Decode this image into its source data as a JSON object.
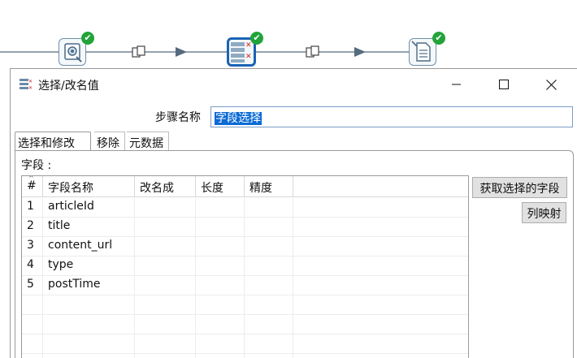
{
  "canvas": {
    "steps": [
      {
        "name": "input-step",
        "status": "ok"
      },
      {
        "name": "select-values-step",
        "status": "ok",
        "selected": true
      },
      {
        "name": "output-step",
        "status": "ok"
      }
    ],
    "ok_glyph": "✔",
    "colors": {
      "hop": "#556b7f",
      "ok": "#22a33a",
      "selected": "#1a63b4"
    }
  },
  "dialog": {
    "title": "选择/改名值",
    "step_name_label": "步骤名称",
    "step_name_value": "字段选择",
    "tabs": [
      {
        "label": "选择和修改",
        "active": true
      },
      {
        "label": "移除",
        "active": false
      },
      {
        "label": "元数据",
        "active": false
      }
    ],
    "fields_label": "字段 :",
    "table": {
      "columns": [
        "#",
        "字段名称",
        "改名成",
        "长度",
        "精度"
      ],
      "rows": [
        {
          "num": "1",
          "field": "articleId",
          "rename": "",
          "length": "",
          "precision": ""
        },
        {
          "num": "2",
          "field": "title",
          "rename": "",
          "length": "",
          "precision": ""
        },
        {
          "num": "3",
          "field": "content_url",
          "rename": "",
          "length": "",
          "precision": ""
        },
        {
          "num": "4",
          "field": "type",
          "rename": "",
          "length": "",
          "precision": ""
        },
        {
          "num": "5",
          "field": "postTime",
          "rename": "",
          "length": "",
          "precision": ""
        }
      ]
    },
    "buttons": {
      "get_fields": "获取选择的字段",
      "column_mapping": "列映射"
    },
    "window_controls": {
      "minimize": "minimize-icon",
      "maximize": "maximize-icon",
      "close": "close-icon"
    }
  }
}
